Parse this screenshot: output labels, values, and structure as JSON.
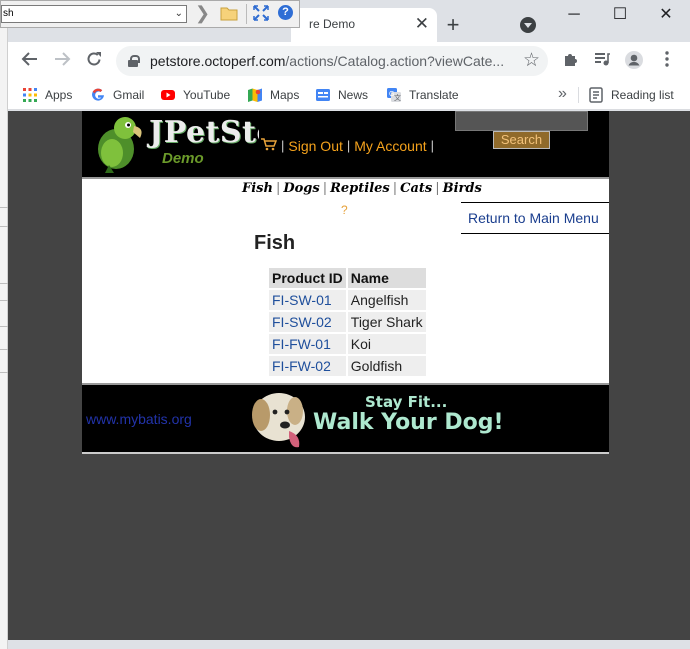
{
  "browser": {
    "active_tab_title": "re Demo",
    "new_tab_symbol": "+",
    "close_tab_symbol": "✕",
    "minimize_symbol": "─",
    "maximize_symbol": "☐",
    "close_symbol": "✕"
  },
  "toolbar": {
    "url_host": "petstore.octoperf.com",
    "url_rest": "/actions/Catalog.action?viewCate..."
  },
  "bookmarks": {
    "items": [
      {
        "label": "Apps",
        "icon": "apps-grid-icon"
      },
      {
        "label": "Gmail",
        "icon": "google-icon"
      },
      {
        "label": "YouTube",
        "icon": "youtube-icon"
      },
      {
        "label": "Maps",
        "icon": "maps-icon"
      },
      {
        "label": "News",
        "icon": "news-icon"
      },
      {
        "label": "Translate",
        "icon": "translate-icon"
      }
    ],
    "more_symbol": "»",
    "reading_list": "Reading list"
  },
  "header": {
    "logo_word": "JPetSto",
    "logo_demo": "Demo",
    "sign_out": "Sign Out",
    "my_account": "My Account",
    "separator": "|",
    "search_button": "Search"
  },
  "quick_links": {
    "fish": "Fish",
    "dogs": "Dogs",
    "reptiles": "Reptiles",
    "cats": "Cats",
    "birds": "Birds",
    "separator": "|"
  },
  "help_link": "?",
  "return_link": "Return to Main Menu",
  "category_title": "Fish",
  "table": {
    "headers": [
      "Product ID",
      "Name"
    ],
    "rows": [
      {
        "id": "FI-SW-01",
        "name": "Angelfish"
      },
      {
        "id": "FI-SW-02",
        "name": "Tiger Shark"
      },
      {
        "id": "FI-FW-01",
        "name": "Koi"
      },
      {
        "id": "FI-FW-02",
        "name": "Goldfish"
      }
    ]
  },
  "footer": {
    "mybatis_link": "www.mybatis.org",
    "banner_line1": "Stay Fit...",
    "banner_line2": "Walk Your Dog!"
  },
  "dialog": {
    "path_text": "sh",
    "help_symbol": "?"
  },
  "colors": {
    "link_orange": "#f4a21c",
    "link_blue": "#1f4f9c",
    "banner_text": "#aee8cf"
  }
}
